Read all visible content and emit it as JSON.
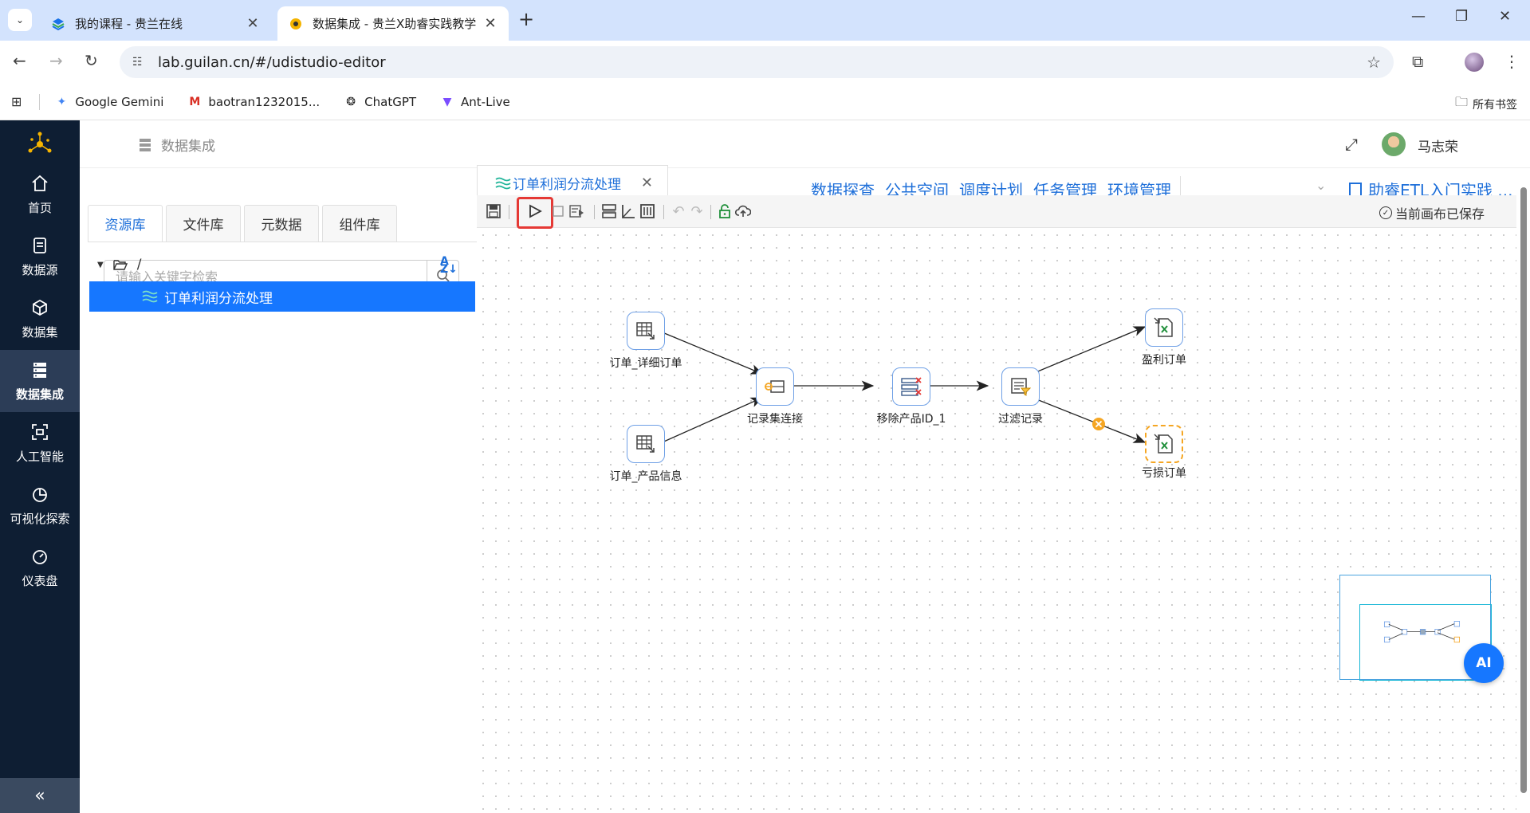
{
  "browser": {
    "tabs": [
      {
        "title": "我的课程 - 贵兰在线",
        "active": false
      },
      {
        "title": "数据集成 - 贵兰X助睿实践教学",
        "active": true
      }
    ],
    "url": "lab.guilan.cn/#/udistudio-editor",
    "bookmarks": [
      {
        "label": "Google Gemini",
        "icon": "gemini-icon"
      },
      {
        "label": "baotran1232015...",
        "icon": "gmail-icon"
      },
      {
        "label": "ChatGPT",
        "icon": "chatgpt-icon"
      },
      {
        "label": "Ant-Live",
        "icon": "ant-live-icon"
      }
    ],
    "all_bookmarks": "所有书签"
  },
  "nav": {
    "items": [
      {
        "label": "首页",
        "icon": "home-icon"
      },
      {
        "label": "数据源",
        "icon": "datasource-icon"
      },
      {
        "label": "数据集",
        "icon": "dataset-icon"
      },
      {
        "label": "数据集成",
        "icon": "integration-icon",
        "active": true
      },
      {
        "label": "人工智能",
        "icon": "ai-icon"
      },
      {
        "label": "可视化探索",
        "icon": "chart-icon"
      },
      {
        "label": "仪表盘",
        "icon": "dashboard-icon"
      }
    ],
    "collapse": "«"
  },
  "header": {
    "module": "数据集成",
    "user": "马志荣"
  },
  "submenu": {
    "links": [
      "数据探查",
      "公共空间",
      "调度计划",
      "任务管理",
      "环境管理"
    ],
    "project": "助睿ETL入门实践 ..."
  },
  "left_panel": {
    "tabs": [
      "资源库",
      "文件库",
      "元数据",
      "组件库"
    ],
    "active_tab": "资源库",
    "search_placeholder": "请输入关键字检索",
    "root": "/",
    "items": [
      "订单利润分流处理"
    ]
  },
  "editor": {
    "tab_title": "订单利润分流处理",
    "status": "当前画布已保存",
    "nodes": [
      {
        "id": "n1",
        "label": "订单_详细订单",
        "type": "table-input"
      },
      {
        "id": "n2",
        "label": "订单_产品信息",
        "type": "table-input"
      },
      {
        "id": "n3",
        "label": "记录集连接",
        "type": "join"
      },
      {
        "id": "n4",
        "label": "移除产品ID_1",
        "type": "remove-field"
      },
      {
        "id": "n5",
        "label": "过滤记录",
        "type": "filter"
      },
      {
        "id": "n6",
        "label": "盈利订单",
        "type": "excel-output"
      },
      {
        "id": "n7",
        "label": "亏损订单",
        "type": "excel-output",
        "selected": true
      }
    ],
    "edges": [
      {
        "from": "n1",
        "to": "n3"
      },
      {
        "from": "n2",
        "to": "n3"
      },
      {
        "from": "n3",
        "to": "n4"
      },
      {
        "from": "n4",
        "to": "n5"
      },
      {
        "from": "n5",
        "to": "n6",
        "kind": "true"
      },
      {
        "from": "n5",
        "to": "n7",
        "kind": "false"
      }
    ],
    "ai_button": "AI"
  },
  "colors": {
    "accent": "#1677ff",
    "nav_bg": "#0e1e33",
    "run_highlight": "#e53935",
    "link": "#1e6fd9"
  }
}
